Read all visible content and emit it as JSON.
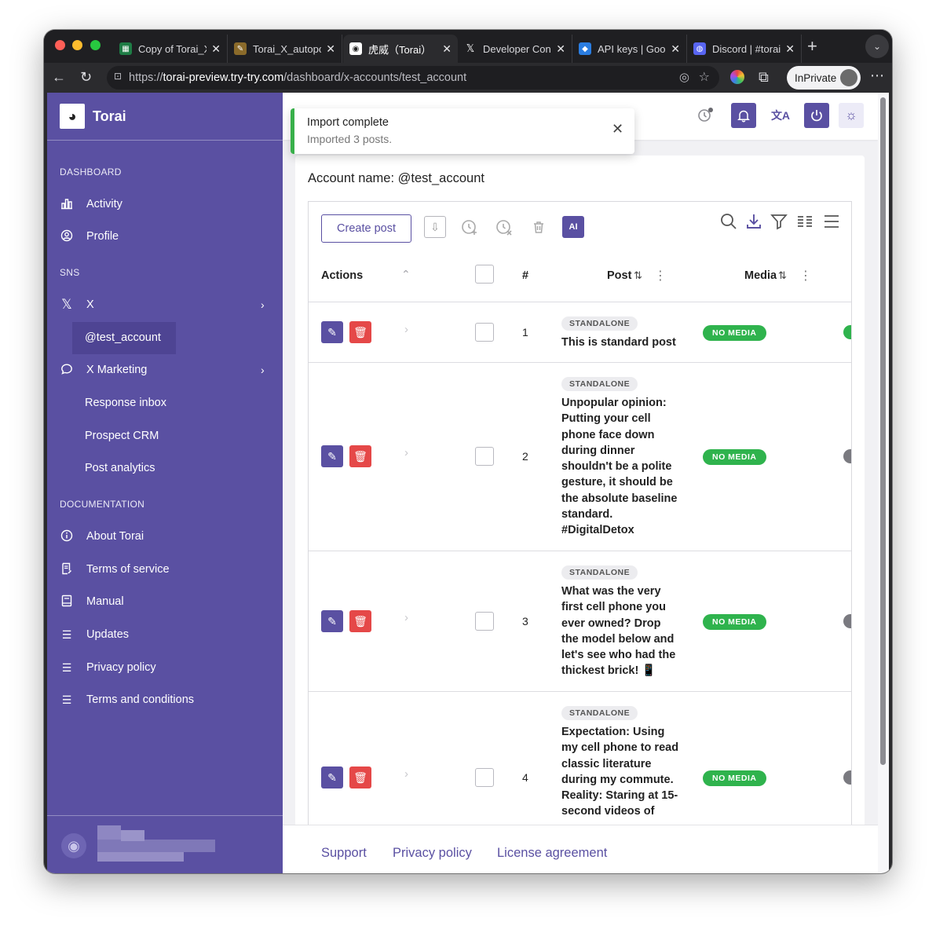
{
  "browser": {
    "tabs": [
      {
        "label": "Copy of Torai_X",
        "favicon_color": "#1e7c45"
      },
      {
        "label": "Torai_X_autopo",
        "favicon_color": "#8a6a2a"
      },
      {
        "label": "虎威（Torai）",
        "favicon_color": "#ffffff"
      },
      {
        "label": "Developer Cons",
        "favicon_color": "#000000"
      },
      {
        "label": "API keys | Goog",
        "favicon_color": "#2a7de1"
      },
      {
        "label": "Discord | #torai",
        "favicon_color": "#5865f2"
      }
    ],
    "url_scheme": "https://",
    "url_host": "torai-preview.try-try.com",
    "url_path": "/dashboard/x-accounts/test_account",
    "inprivate_label": "InPrivate"
  },
  "sidebar": {
    "brand": "Torai",
    "sections": {
      "dashboard": "DASHBOARD",
      "sns": "SNS",
      "documentation": "DOCUMENTATION"
    },
    "items": {
      "activity": "Activity",
      "profile": "Profile",
      "x": "X",
      "test_account": "@test_account",
      "x_marketing": "X Marketing",
      "response_inbox": "Response inbox",
      "prospect_crm": "Prospect CRM",
      "post_analytics": "Post analytics",
      "about": "About Torai",
      "terms_of_service": "Terms of service",
      "manual": "Manual",
      "updates": "Updates",
      "privacy_policy": "Privacy policy",
      "terms_and_conditions": "Terms and conditions"
    }
  },
  "toast": {
    "title": "Import complete",
    "message": "Imported 3 posts."
  },
  "main": {
    "account_label": "Account name: @test_account",
    "create_post": "Create post",
    "ai_label": "AI",
    "columns": {
      "actions": "Actions",
      "number": "#",
      "post": "Post",
      "media": "Media"
    },
    "rows": [
      {
        "num": "1",
        "tag": "STANDALONE",
        "text": "This is standard post",
        "media": "NO MEDIA",
        "status_color": "#2fb34d"
      },
      {
        "num": "2",
        "tag": "STANDALONE",
        "text": "Unpopular opinion: Putting your cell phone face down during dinner shouldn't be a polite gesture, it should be the absolute baseline standard. #DigitalDetox",
        "media": "NO MEDIA",
        "status_color": "#7a7a80"
      },
      {
        "num": "3",
        "tag": "STANDALONE",
        "text": "What was the very first cell phone you ever owned? Drop the model below and let's see who had the thickest brick! 📱",
        "media": "NO MEDIA",
        "status_color": "#7a7a80"
      },
      {
        "num": "4",
        "tag": "STANDALONE",
        "text": "Expectation: Using my cell phone to read classic literature during my commute. Reality: Staring at 15-second videos of",
        "media": "NO MEDIA",
        "status_color": "#7a7a80"
      }
    ]
  },
  "footer": {
    "support": "Support",
    "privacy": "Privacy policy",
    "license": "License agreement"
  },
  "colors": {
    "brand": "#5a50a2",
    "success": "#2fb34d",
    "danger": "#e54848"
  }
}
